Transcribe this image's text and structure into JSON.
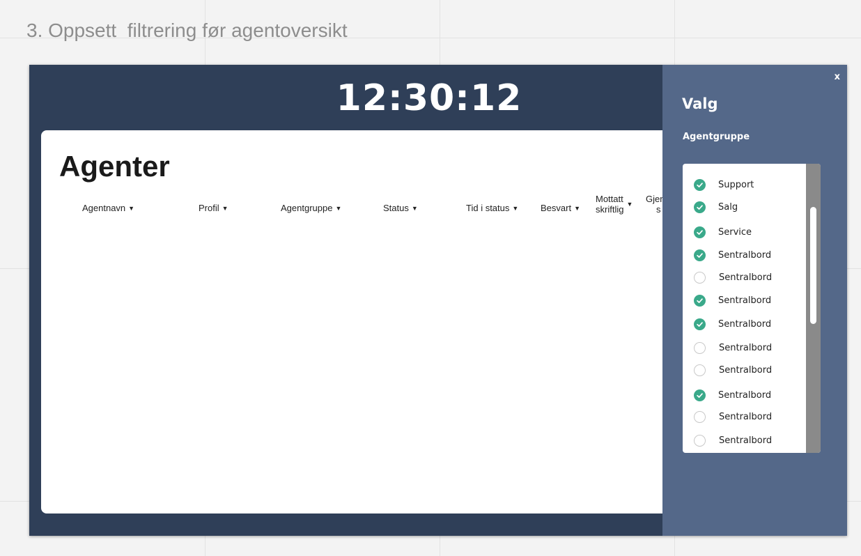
{
  "page": {
    "heading": "3. Oppsett  filtrering før agentoversikt"
  },
  "wallboard": {
    "clock": "12:30:12",
    "panel_title": "Agenter",
    "columns": [
      {
        "label": "Agentnavn"
      },
      {
        "label": "Profil"
      },
      {
        "label": "Agentgruppe"
      },
      {
        "label": "Status"
      },
      {
        "label": "Tid i status"
      },
      {
        "label": "Besvart"
      },
      {
        "label_line1": "Mottatt",
        "label_line2": "skriftlig"
      },
      {
        "label_line1": "Gjen",
        "label_line2": "s"
      }
    ]
  },
  "sidebar": {
    "close_label": "x",
    "title": "Valg",
    "subtitle": "Agentgruppe",
    "items": [
      {
        "label": "Support",
        "checked": true
      },
      {
        "label": "Salg",
        "checked": true
      },
      {
        "label": "Service",
        "checked": true
      },
      {
        "label": "Sentralbord",
        "checked": true
      },
      {
        "label": "Sentralbord",
        "checked": false
      },
      {
        "label": "Sentralbord",
        "checked": true
      },
      {
        "label": "Sentralbord",
        "checked": true
      },
      {
        "label": "Sentralbord",
        "checked": false
      },
      {
        "label": "Sentralbord",
        "checked": false
      },
      {
        "label": "Sentralbord",
        "checked": true
      },
      {
        "label": "Sentralbord",
        "checked": false
      },
      {
        "label": "Sentralbord",
        "checked": false
      }
    ]
  },
  "colors": {
    "frame_bg": "#2f3f58",
    "sidebar_bg": "#546889",
    "check_on": "#3aa98a",
    "check_off_border": "#c8c8c8"
  },
  "icons": {
    "caret": "caret-down-icon",
    "check": "check-circle-icon"
  }
}
